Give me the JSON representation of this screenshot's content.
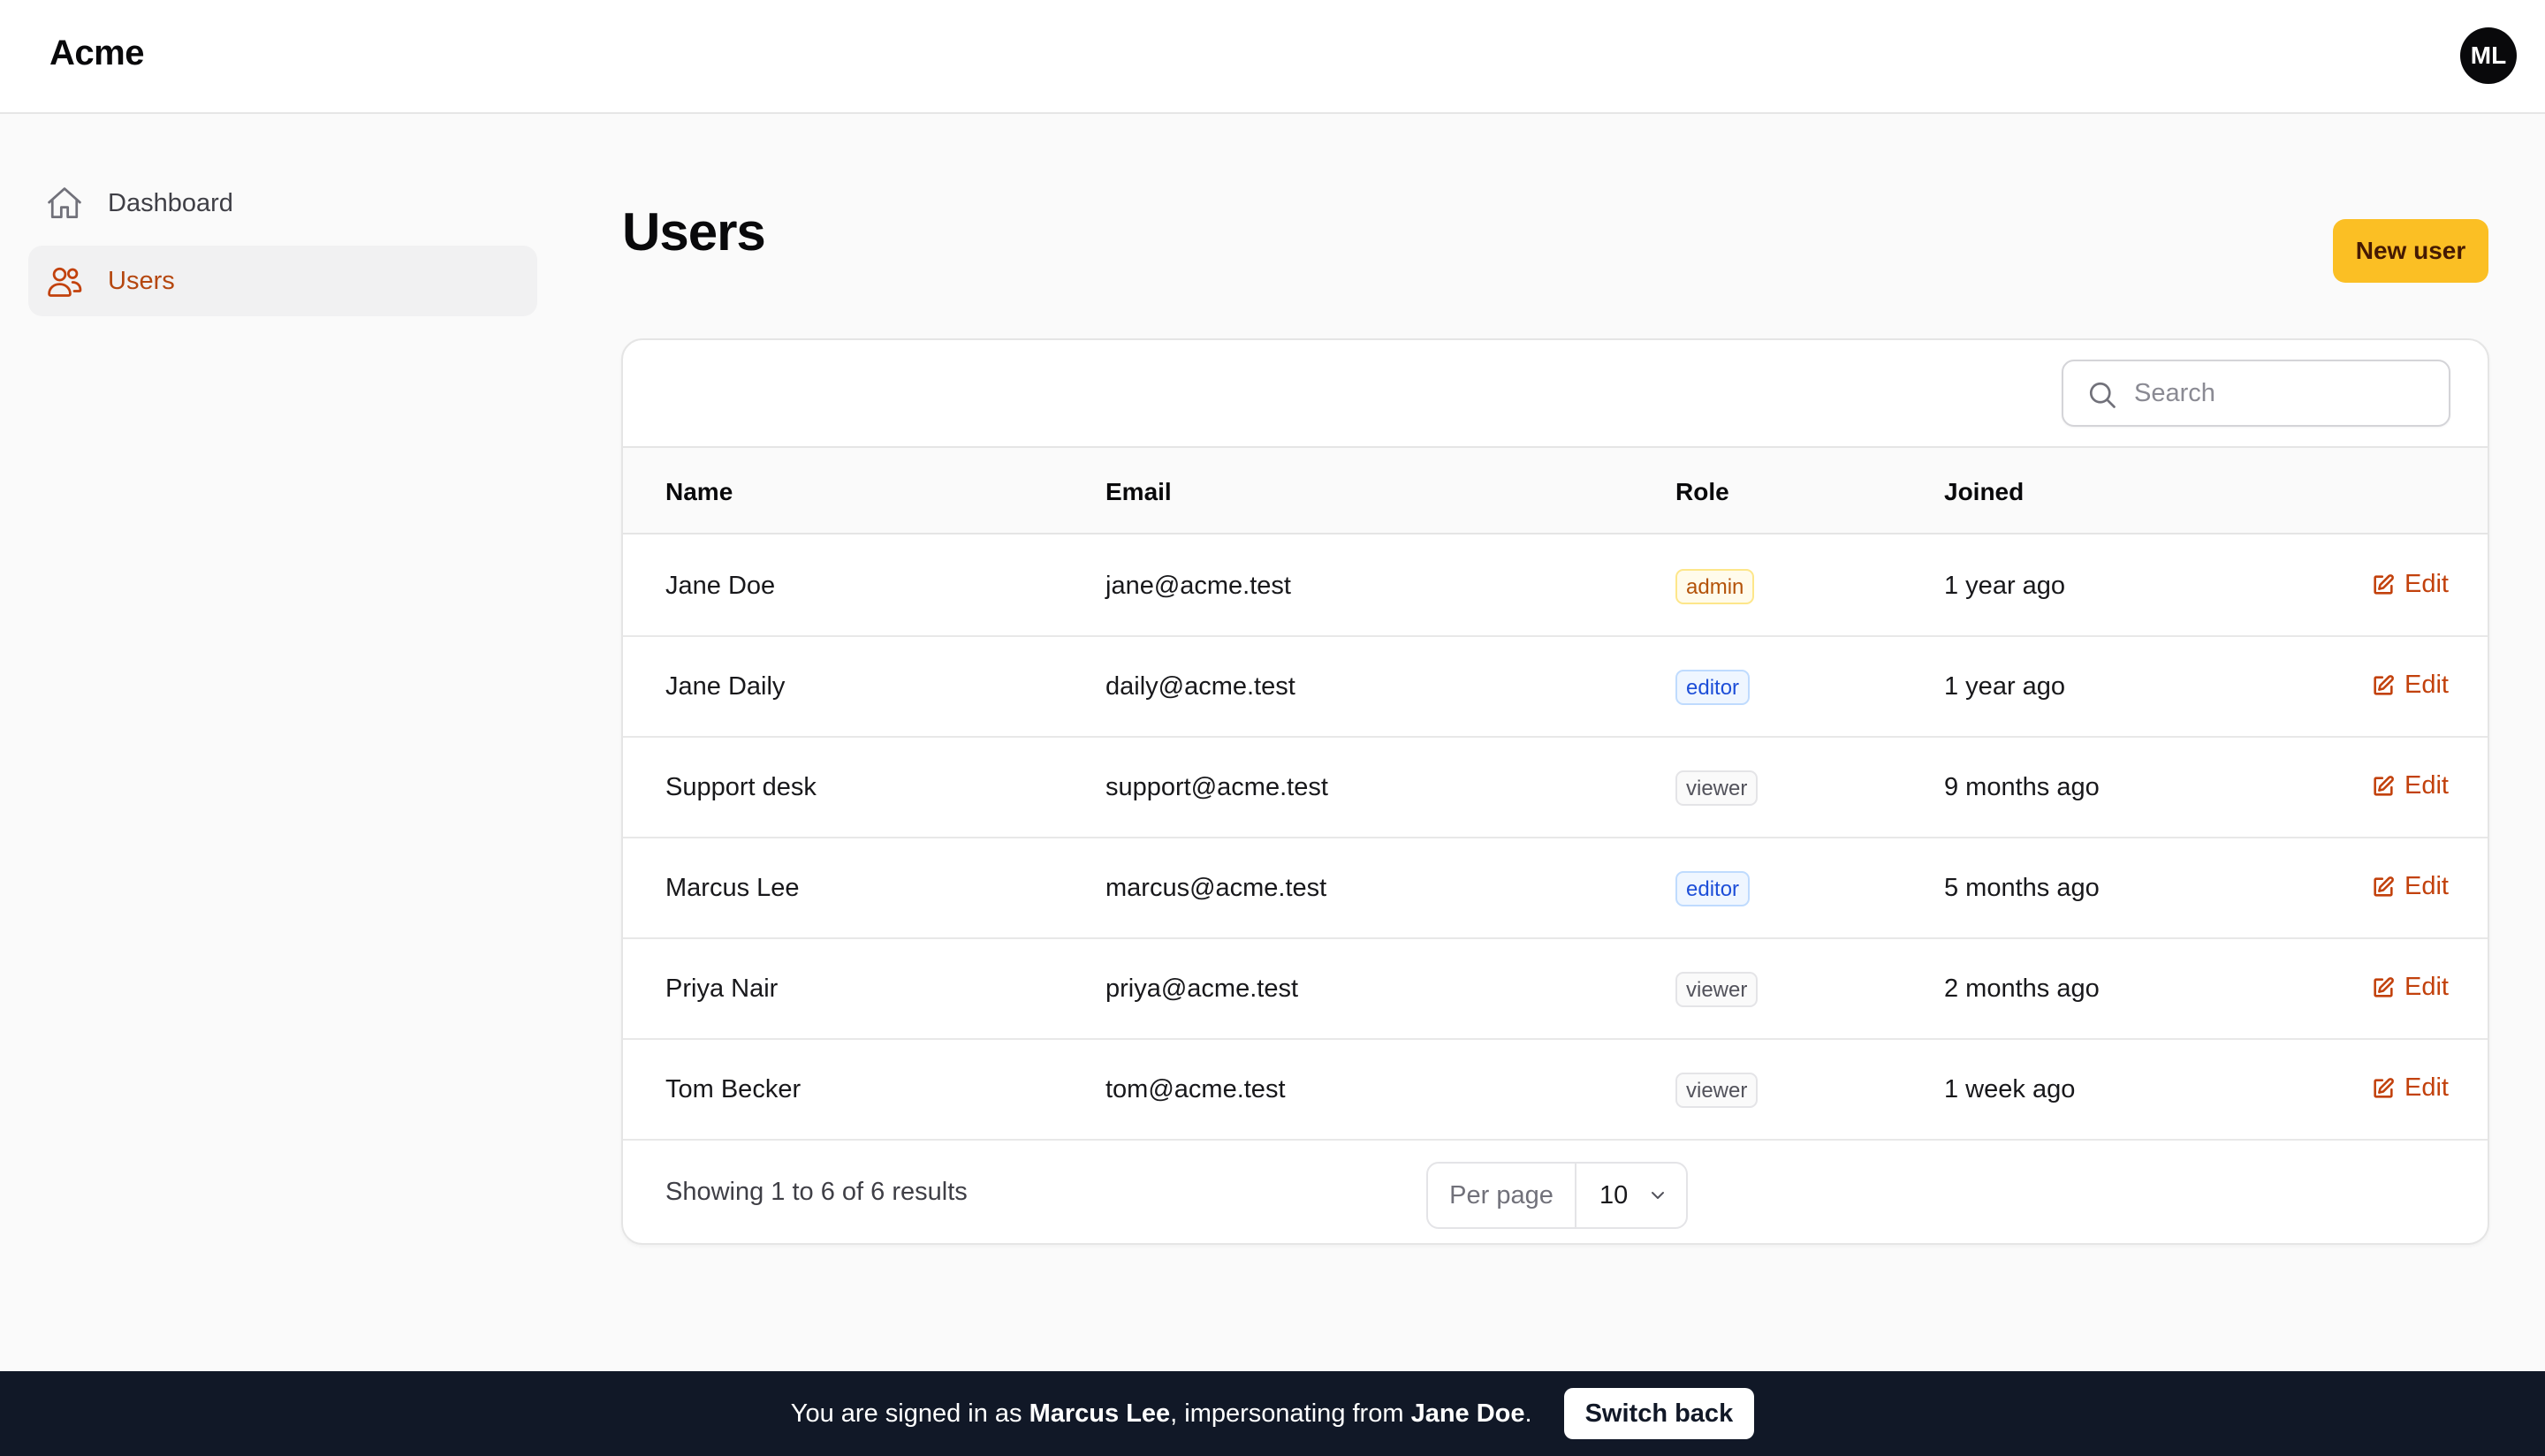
{
  "app": {
    "brand": "Acme",
    "avatar_initials": "ML"
  },
  "sidebar": {
    "items": [
      {
        "label": "Dashboard",
        "icon": "home-icon",
        "active": false
      },
      {
        "label": "Users",
        "icon": "users-icon",
        "active": true
      }
    ]
  },
  "page": {
    "title": "Users",
    "new_button": "New user"
  },
  "search": {
    "placeholder": "Search",
    "value": ""
  },
  "table": {
    "columns": [
      "Name",
      "Email",
      "Role",
      "Joined"
    ],
    "rows": [
      {
        "name": "Jane Doe",
        "email": "jane@acme.test",
        "role": "admin",
        "joined": "1 year ago",
        "action": "Edit"
      },
      {
        "name": "Jane Daily",
        "email": "daily@acme.test",
        "role": "editor",
        "joined": "1 year ago",
        "action": "Edit"
      },
      {
        "name": "Support desk",
        "email": "support@acme.test",
        "role": "viewer",
        "joined": "9 months ago",
        "action": "Edit"
      },
      {
        "name": "Marcus Lee",
        "email": "marcus@acme.test",
        "role": "editor",
        "joined": "5 months ago",
        "action": "Edit"
      },
      {
        "name": "Priya Nair",
        "email": "priya@acme.test",
        "role": "viewer",
        "joined": "2 months ago",
        "action": "Edit"
      },
      {
        "name": "Tom Becker",
        "email": "tom@acme.test",
        "role": "viewer",
        "joined": "1 week ago",
        "action": "Edit"
      }
    ]
  },
  "pagination": {
    "summary": "Showing 1 to 6 of 6 results",
    "per_page_label": "Per page",
    "per_page_value": "10"
  },
  "banner": {
    "prefix": "You are signed in as ",
    "current_user": "Marcus Lee",
    "middle": ", impersonating from ",
    "original_user": "Jane Doe",
    "suffix": ".",
    "switch_label": "Switch back"
  },
  "colors": {
    "accent": "#c2410c",
    "button": "#fbbf24",
    "banner": "#111827"
  }
}
